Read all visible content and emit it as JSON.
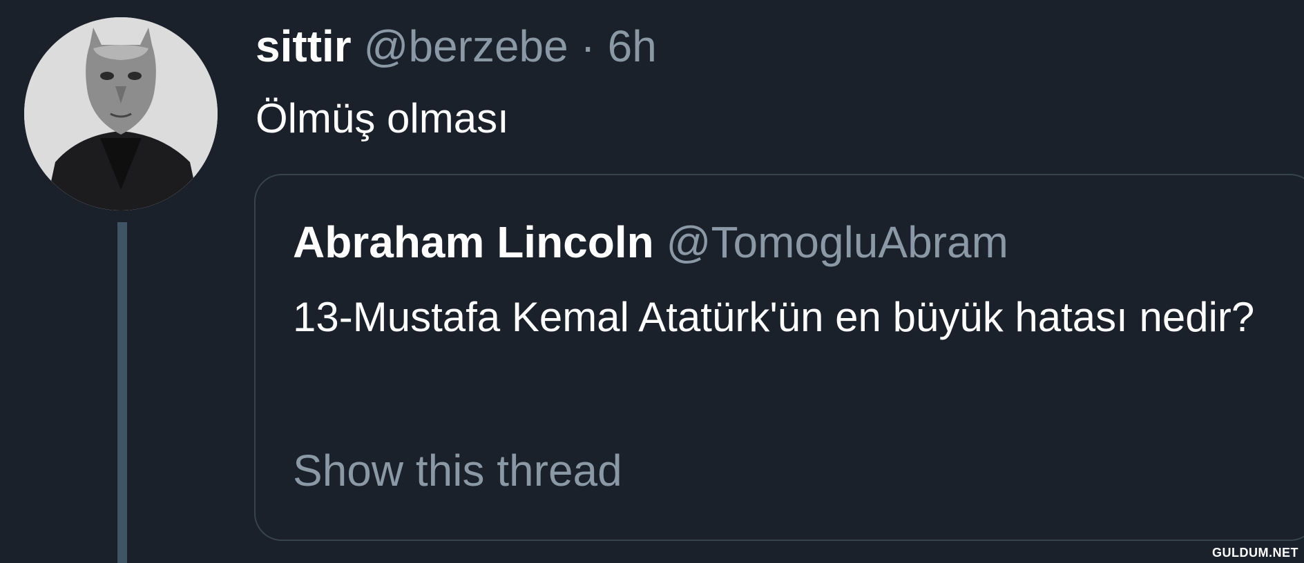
{
  "tweet": {
    "display_name": "sittir",
    "handle": "@berzebe",
    "separator": "·",
    "time": "6h",
    "text": "Ölmüş olması",
    "avatar": "avatar-masked-figure"
  },
  "quoted_tweet": {
    "display_name": "Abraham Lincoln",
    "handle": "@TomogluAbram",
    "text": "13-Mustafa Kemal Atatürk'ün en büyük hatası nedir?",
    "show_thread": "Show this thread"
  },
  "watermark": "GULDUM.NET",
  "colors": {
    "background": "#1a212b",
    "secondary_text": "#8b98a5",
    "border": "#38444d",
    "thread_line": "#3f5566"
  }
}
